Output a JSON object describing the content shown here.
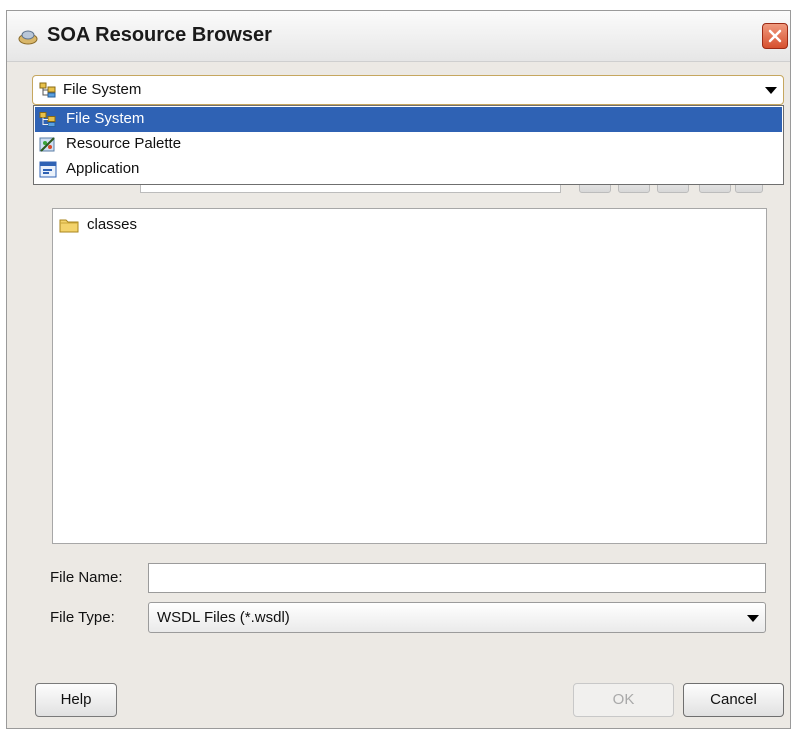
{
  "window": {
    "title": "SOA Resource Browser"
  },
  "source_selector": {
    "selected": "File System",
    "options": [
      {
        "label": "File System",
        "icon": "file-system-icon",
        "selected": true
      },
      {
        "label": "Resource Palette",
        "icon": "resource-palette-icon",
        "selected": false
      },
      {
        "label": "Application",
        "icon": "application-icon",
        "selected": false
      }
    ]
  },
  "file_list": {
    "items": [
      {
        "label": "classes",
        "icon": "folder-icon"
      }
    ]
  },
  "form": {
    "file_name_label": "File Name:",
    "file_name_value": "",
    "file_type_label": "File Type:",
    "file_type_value": "WSDL Files (*.wsdl)"
  },
  "buttons": {
    "help": "Help",
    "ok": "OK",
    "cancel": "Cancel"
  },
  "colors": {
    "selection": "#2f62b4",
    "close_button": "#d6502f",
    "dialog_bg": "#ece9e4"
  }
}
